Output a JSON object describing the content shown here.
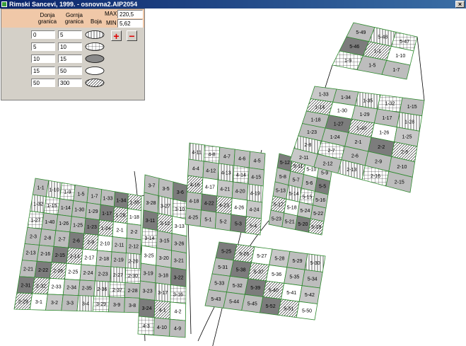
{
  "window": {
    "title": "Rimski Sancevi, 1999. - osnovna2.AIP2054",
    "close_label": "×"
  },
  "panel": {
    "header_lower": "Donja\ngranica",
    "header_upper": "Gornja\ngranica",
    "header_color": "Boja",
    "max_label": "MAX",
    "min_label": "MIN",
    "max_value": "220,5",
    "min_value": "5,62",
    "add_label": "+",
    "remove_label": "−",
    "ranges": [
      {
        "lower": "0",
        "upper": "5",
        "pattern": "vertical-lines"
      },
      {
        "lower": "5",
        "upper": "10",
        "pattern": "grid"
      },
      {
        "lower": "10",
        "upper": "15",
        "pattern": "dark-fill"
      },
      {
        "lower": "15",
        "upper": "50",
        "pattern": "light-fill"
      },
      {
        "lower": "50",
        "upper": "300",
        "pattern": "diagonal-lines"
      }
    ]
  },
  "parcels": [
    {
      "label": "1-1"
    },
    {
      "label": "1-10"
    },
    {
      "label": "1-9"
    },
    {
      "label": "1-5"
    },
    {
      "label": "1-7"
    },
    {
      "label": "1-33"
    },
    {
      "label": "1-34"
    },
    {
      "label": "1-35"
    },
    {
      "label": "1-32"
    },
    {
      "label": "1-15"
    },
    {
      "label": "1-14"
    },
    {
      "label": "1-30"
    },
    {
      "label": "1-29"
    },
    {
      "label": "1-17"
    },
    {
      "label": "1-28"
    },
    {
      "label": "1-18"
    },
    {
      "label": "1-27"
    },
    {
      "label": "1-40"
    },
    {
      "label": "1-26"
    },
    {
      "label": "1-25"
    },
    {
      "label": "1-23"
    },
    {
      "label": "1-24"
    },
    {
      "label": "2-1"
    },
    {
      "label": "2-2"
    },
    {
      "label": "2-3"
    },
    {
      "label": "2-8"
    },
    {
      "label": "2-7"
    },
    {
      "label": "2-6"
    },
    {
      "label": "2-9"
    },
    {
      "label": "2-10"
    },
    {
      "label": "2-11"
    },
    {
      "label": "2-12"
    },
    {
      "label": "2-13"
    },
    {
      "label": "2-16"
    },
    {
      "label": "2-15"
    },
    {
      "label": "2-14"
    },
    {
      "label": "2-17"
    },
    {
      "label": "2-18"
    },
    {
      "label": "2-19"
    },
    {
      "label": "2-20"
    },
    {
      "label": "2-21"
    },
    {
      "label": "2-22"
    },
    {
      "label": "2-26"
    },
    {
      "label": "2-25"
    },
    {
      "label": "2-24"
    },
    {
      "label": "2-23"
    },
    {
      "label": "2-27"
    },
    {
      "label": "2-30"
    },
    {
      "label": "2-31"
    },
    {
      "label": "2-32"
    },
    {
      "label": "2-33"
    },
    {
      "label": "2-34"
    },
    {
      "label": "2-35"
    },
    {
      "label": "2-36"
    },
    {
      "label": "2-37"
    },
    {
      "label": "2-28"
    },
    {
      "label": "2-29"
    },
    {
      "label": "3-1"
    },
    {
      "label": "3-2"
    },
    {
      "label": "3-3"
    },
    {
      "label": "3-4"
    },
    {
      "label": "3-29"
    },
    {
      "label": "3-9"
    },
    {
      "label": "3-8"
    },
    {
      "label": "3-7"
    },
    {
      "label": "3-5"
    },
    {
      "label": "3-6"
    },
    {
      "label": "3-28"
    },
    {
      "label": "3-27"
    },
    {
      "label": "3-10"
    },
    {
      "label": "3-11"
    },
    {
      "label": "3-12"
    },
    {
      "label": "3-13"
    },
    {
      "label": "3-14"
    },
    {
      "label": "3-15"
    },
    {
      "label": "3-26"
    },
    {
      "label": "3-25"
    },
    {
      "label": "3-20"
    },
    {
      "label": "3-21"
    },
    {
      "label": "3-19"
    },
    {
      "label": "3-18"
    },
    {
      "label": "3-22"
    },
    {
      "label": "3-23"
    },
    {
      "label": "3-17"
    },
    {
      "label": "3-16"
    },
    {
      "label": "3-24"
    },
    {
      "label": "4-1"
    },
    {
      "label": "4-2"
    },
    {
      "label": "4-3"
    },
    {
      "label": "4-10"
    },
    {
      "label": "4-9"
    },
    {
      "label": "4-11"
    },
    {
      "label": "4-8"
    },
    {
      "label": "4-7"
    },
    {
      "label": "4-6"
    },
    {
      "label": "4-5"
    },
    {
      "label": "4-4"
    },
    {
      "label": "4-12"
    },
    {
      "label": "4-13"
    },
    {
      "label": "4-14"
    },
    {
      "label": "4-15"
    },
    {
      "label": "4-16"
    },
    {
      "label": "4-17"
    },
    {
      "label": "4-21"
    },
    {
      "label": "4-20"
    },
    {
      "label": "4-19"
    },
    {
      "label": "4-18"
    },
    {
      "label": "4-22"
    },
    {
      "label": "4-23"
    },
    {
      "label": "4-26"
    },
    {
      "label": "4-24"
    },
    {
      "label": "4-25"
    },
    {
      "label": "5-1"
    },
    {
      "label": "5-2"
    },
    {
      "label": "5-3"
    },
    {
      "label": "5-4"
    },
    {
      "label": "5-12"
    },
    {
      "label": "5-11"
    },
    {
      "label": "5-10"
    },
    {
      "label": "5-9"
    },
    {
      "label": "5-8"
    },
    {
      "label": "5-7"
    },
    {
      "label": "5-6"
    },
    {
      "label": "5-5"
    },
    {
      "label": "5-13"
    },
    {
      "label": "5-14"
    },
    {
      "label": "5-15"
    },
    {
      "label": "5-16"
    },
    {
      "label": "5-17"
    },
    {
      "label": "5-18"
    },
    {
      "label": "5-24"
    },
    {
      "label": "5-22"
    },
    {
      "label": "5-23"
    },
    {
      "label": "5-21"
    },
    {
      "label": "5-20"
    },
    {
      "label": "5-19"
    },
    {
      "label": "5-25"
    },
    {
      "label": "5-26"
    },
    {
      "label": "5-27"
    },
    {
      "label": "5-28"
    },
    {
      "label": "5-29"
    },
    {
      "label": "5-30"
    },
    {
      "label": "5-31"
    },
    {
      "label": "5-38"
    },
    {
      "label": "5-37"
    },
    {
      "label": "5-36"
    },
    {
      "label": "5-35"
    },
    {
      "label": "5-34"
    },
    {
      "label": "5-33"
    },
    {
      "label": "5-32"
    },
    {
      "label": "5-39"
    },
    {
      "label": "5-40"
    },
    {
      "label": "5-41"
    },
    {
      "label": "5-42"
    },
    {
      "label": "5-43"
    },
    {
      "label": "5-44"
    },
    {
      "label": "5-45"
    },
    {
      "label": "5-52"
    },
    {
      "label": "5-51"
    },
    {
      "label": "5-50"
    },
    {
      "label": "5-49"
    },
    {
      "label": "5-48"
    },
    {
      "label": "5-47"
    },
    {
      "label": "5-46"
    }
  ]
}
